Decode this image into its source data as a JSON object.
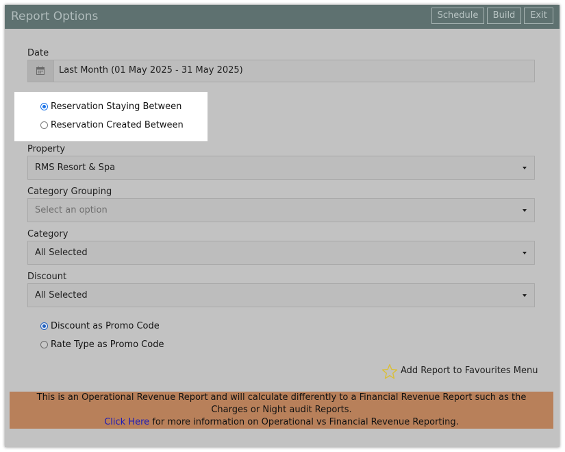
{
  "window": {
    "title": "Report Options",
    "buttons": {
      "schedule": "Schedule",
      "build": "Build",
      "exit": "Exit"
    }
  },
  "date": {
    "label": "Date",
    "value": "Last Month (01 May 2025 - 31 May 2025)",
    "icon": "calendar-icon"
  },
  "reservation_mode": {
    "options": [
      {
        "label": "Reservation Staying Between",
        "selected": true
      },
      {
        "label": "Reservation Created Between",
        "selected": false
      }
    ]
  },
  "property": {
    "label": "Property",
    "value": "RMS Resort & Spa"
  },
  "category_grouping": {
    "label": "Category Grouping",
    "placeholder": "Select an option"
  },
  "category": {
    "label": "Category",
    "value": "All Selected"
  },
  "discount": {
    "label": "Discount",
    "value": "All Selected"
  },
  "promo_mode": {
    "options": [
      {
        "label": "Discount as Promo Code",
        "selected": true
      },
      {
        "label": "Rate Type as Promo Code",
        "selected": false
      }
    ]
  },
  "favourites": {
    "label": "Add Report to Favourites Menu",
    "icon": "star-outline-icon"
  },
  "notice": {
    "line1": "This is an Operational Revenue Report and will calculate differently to a Financial Revenue Report such as the",
    "line2": "Charges or Night audit Reports.",
    "link": "Click Here",
    "line3": " for more information on Operational vs Financial Revenue Reporting."
  },
  "colors": {
    "titlebar": "#5e7170",
    "panel": "#c2c2c2",
    "notice": "#b8805a",
    "radio_accent": "#1a73e8",
    "link": "#1a1ab8"
  }
}
